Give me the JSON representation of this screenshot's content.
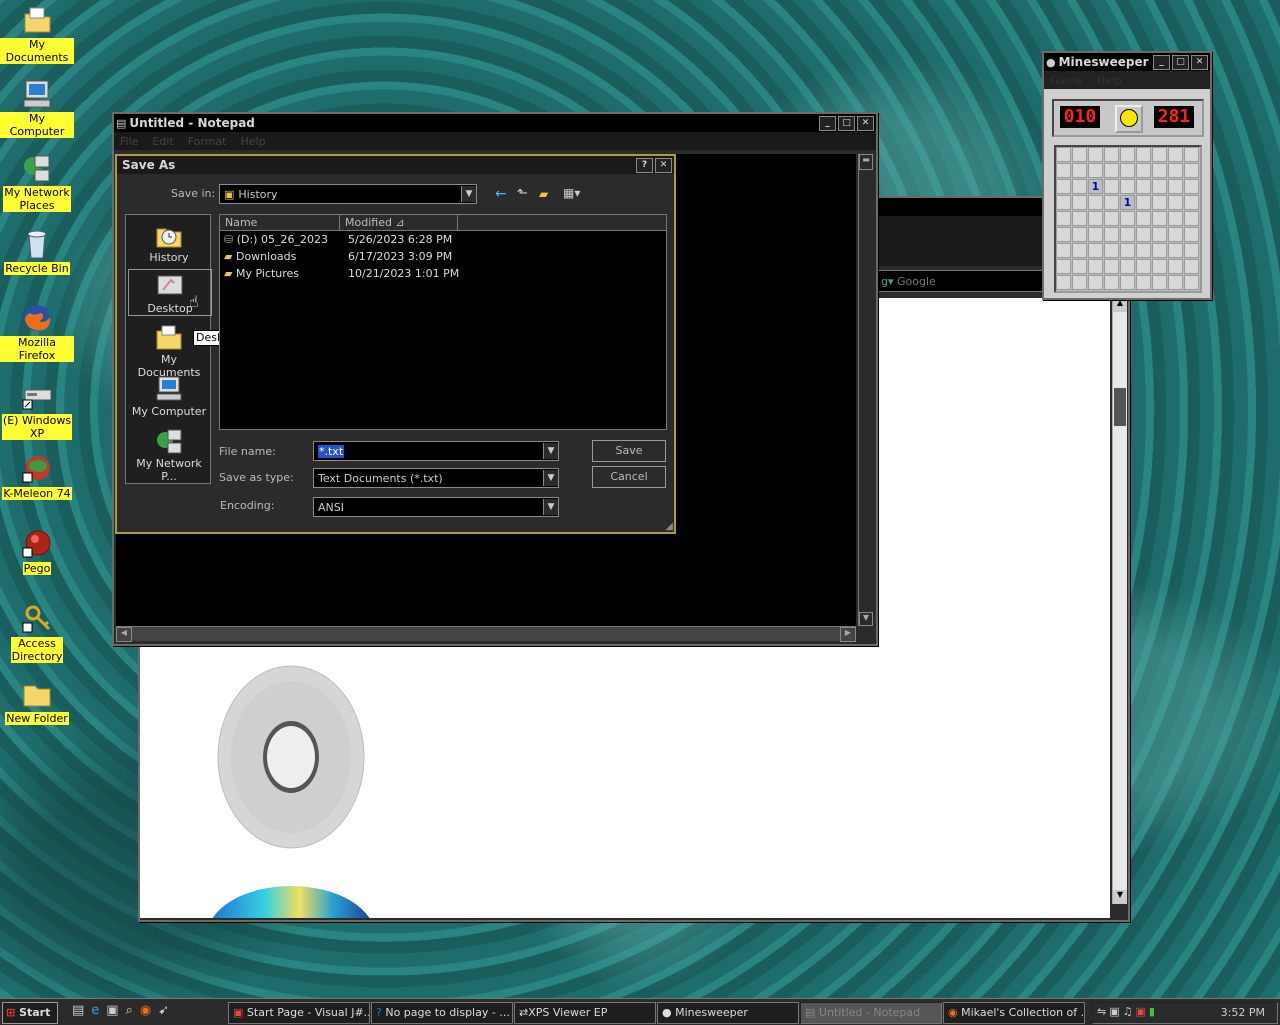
{
  "desktop_icons": [
    {
      "label": "My Documents",
      "icon": "folder-documents-icon"
    },
    {
      "label": "My Computer",
      "icon": "computer-icon"
    },
    {
      "label_line1": "My Network",
      "label_line2": "Places",
      "icon": "network-icon"
    },
    {
      "label": "Recycle Bin",
      "icon": "recycle-bin-icon"
    },
    {
      "label": "Mozilla Firefox",
      "icon": "firefox-icon"
    },
    {
      "label_line1": "(E) Windows",
      "label_line2": "XP",
      "icon": "drive-icon"
    },
    {
      "label": "K-Meleon 74",
      "icon": "kmeleon-icon"
    },
    {
      "label": "Pego",
      "icon": "pego-icon"
    },
    {
      "label_line1": "Access",
      "label_line2": "Directory",
      "icon": "keys-icon"
    },
    {
      "label": "New Folder",
      "icon": "folder-icon"
    }
  ],
  "notepad": {
    "title": "Untitled - Notepad",
    "menu": [
      "File",
      "Edit",
      "Format",
      "Help"
    ]
  },
  "save_as": {
    "title": "Save As",
    "save_in_label": "Save in:",
    "save_in_value": "History",
    "places": [
      "History",
      "Desktop",
      "My Documents",
      "My Computer",
      "My Network P..."
    ],
    "tooltip": "Desktop",
    "columns": [
      "Name",
      "Modified"
    ],
    "files": [
      {
        "name": "(D:) 05_26_2023",
        "modified": "5/26/2023 6:28 PM"
      },
      {
        "name": "Downloads",
        "modified": "6/17/2023 3:09 PM"
      },
      {
        "name": "My Pictures",
        "modified": "10/21/2023 1:01 PM"
      }
    ],
    "file_name_label": "File name:",
    "file_name_value": "*.txt",
    "save_type_label": "Save as type:",
    "save_type_value": "Text Documents (*.txt)",
    "encoding_label": "Encoding:",
    "encoding_value": "ANSI",
    "save_button": "Save",
    "cancel_button": "Cancel"
  },
  "browser": {
    "search_placeholder": "Google"
  },
  "minesweeper": {
    "title": "Minesweeper",
    "menu": [
      "Game",
      "Help"
    ],
    "mines_left": "010",
    "timer": "281",
    "revealed_numbers": [
      "1",
      "1"
    ]
  },
  "taskbar": {
    "start": "Start",
    "tasks": [
      "Start Page - Visual J#...",
      "No page to display - ...",
      "XPS Viewer EP",
      "Minesweeper",
      "Untitled - Notepad",
      "Mikael's Collection of ..."
    ],
    "clock": "3:52 PM"
  }
}
